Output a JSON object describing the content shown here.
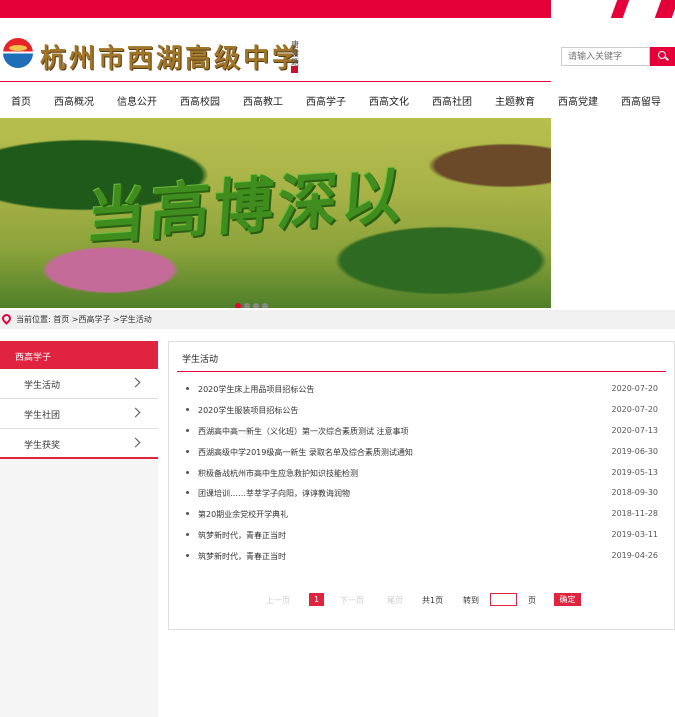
{
  "header": {
    "school_name": "杭州市西湖高级中学",
    "seal_text": "唐雲题",
    "search_placeholder": "请输入关键字"
  },
  "nav": {
    "items": [
      "首页",
      "西高概况",
      "信息公开",
      "西高校园",
      "西高教工",
      "西高学子",
      "西高文化",
      "西高社团",
      "主题教育",
      "西高党建",
      "西高留导"
    ]
  },
  "banner": {
    "hedge_text": "当高博深以",
    "slide_count": 4,
    "active_slide": 1
  },
  "breadcrumb": {
    "text": "当前位置: 首页 >西高学子 >学生活动"
  },
  "sidebar": {
    "title": "西高学子",
    "items": [
      {
        "label": "学生活动"
      },
      {
        "label": "学生社团"
      },
      {
        "label": "学生获奖"
      }
    ]
  },
  "content": {
    "title": "学生活动",
    "news": [
      {
        "title": "2020学生床上用品项目招标公告",
        "date": "2020-07-20"
      },
      {
        "title": "2020学生服装项目招标公告",
        "date": "2020-07-20"
      },
      {
        "title": "西湖高中高一新生（义化班）第一次综合素质测试 注意事项",
        "date": "2020-07-13"
      },
      {
        "title": "西湖高级中学2019级高一新生 录取名单及综合素质测试通知",
        "date": "2019-06-30"
      },
      {
        "title": "积极备战杭州市高中生应急救护知识技能检测",
        "date": "2019-05-13"
      },
      {
        "title": "团课培训……莘莘学子向阳，谆谆教诲润物",
        "date": "2018-09-30"
      },
      {
        "title": "第20期业余党校开学典礼",
        "date": "2018-11-28"
      },
      {
        "title": "筑梦新时代，青春正当时",
        "date": "2019-03-11"
      },
      {
        "title": "筑梦新时代，青春正当时",
        "date": "2019-04-26"
      }
    ]
  },
  "pager": {
    "prev": "上一页",
    "current": "1",
    "next": "下一页",
    "last": "尾页",
    "total": "共1页",
    "goto": "转到",
    "unit": "页",
    "confirm": "确定"
  },
  "colors": {
    "accent": "#e60039",
    "sidebar_title_bg": "#e0243f"
  }
}
